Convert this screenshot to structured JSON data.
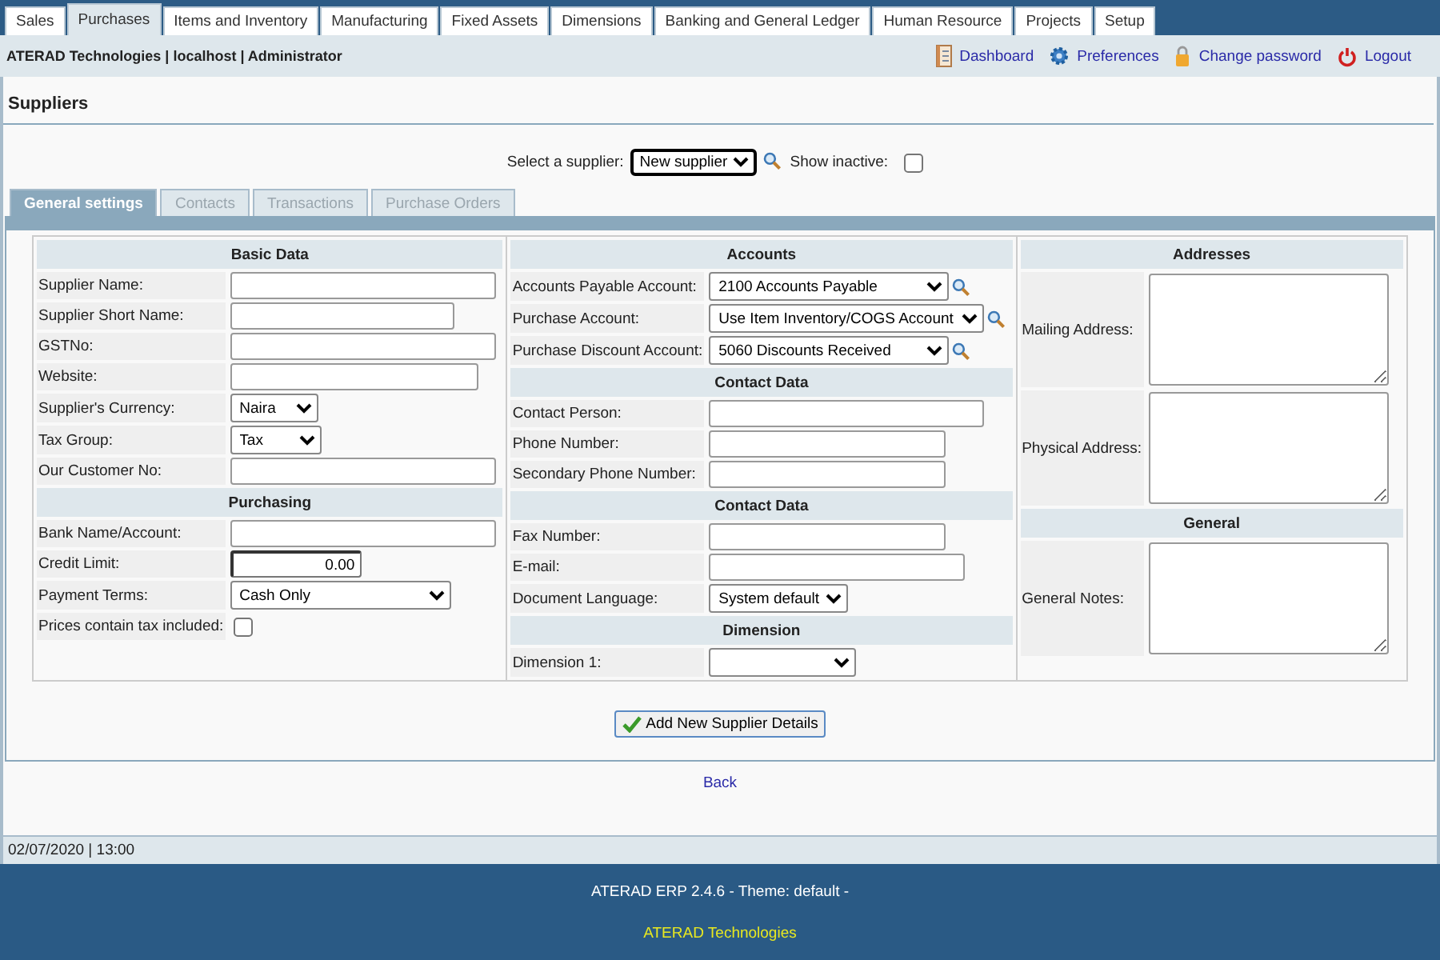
{
  "menu_tabs": [
    {
      "label": "Sales",
      "selected": false
    },
    {
      "label": "Purchases",
      "selected": true
    },
    {
      "label": "Items and Inventory",
      "selected": false
    },
    {
      "label": "Manufacturing",
      "selected": false
    },
    {
      "label": "Fixed Assets",
      "selected": false
    },
    {
      "label": "Dimensions",
      "selected": false
    },
    {
      "label": "Banking and General Ledger",
      "selected": false
    },
    {
      "label": "Human Resource",
      "selected": false
    },
    {
      "label": "Projects",
      "selected": false
    },
    {
      "label": "Setup",
      "selected": false
    }
  ],
  "user_bar": {
    "info": "ATERAD Technologies | localhost | Administrator",
    "links": [
      {
        "label": "Dashboard",
        "kind": "dashboard"
      },
      {
        "label": "Preferences",
        "kind": "preferences"
      },
      {
        "label": "Change password",
        "kind": "password"
      },
      {
        "label": "Logout",
        "kind": "logout"
      }
    ]
  },
  "page_title": "Suppliers",
  "supplier_select": {
    "label": "Select a supplier:",
    "value": "New supplier",
    "show_inactive_label": "Show inactive:",
    "show_inactive": false
  },
  "form_tabs": [
    {
      "label": "General settings",
      "selected": true
    },
    {
      "label": "Contacts",
      "selected": false
    },
    {
      "label": "Transactions",
      "selected": false
    },
    {
      "label": "Purchase Orders",
      "selected": false
    }
  ],
  "columns": [
    [
      {
        "kind": "header",
        "label": "Basic Data"
      },
      {
        "kind": "text",
        "label": "Supplier Name:"
      },
      {
        "kind": "text",
        "label": "Supplier Short Name:"
      },
      {
        "kind": "text",
        "label": "GSTNo:"
      },
      {
        "kind": "text",
        "label": "Website:"
      },
      {
        "kind": "select",
        "label": "Supplier's Currency:",
        "value": "Naira"
      },
      {
        "kind": "select",
        "label": "Tax Group:",
        "value": "Tax"
      },
      {
        "kind": "text",
        "label": "Our Customer No:"
      },
      {
        "kind": "header",
        "label": "Purchasing"
      },
      {
        "kind": "text",
        "label": "Bank Name/Account:"
      },
      {
        "kind": "number",
        "label": "Credit Limit:",
        "value": "0.00"
      },
      {
        "kind": "select",
        "label": "Payment Terms:",
        "value": "Cash Only"
      },
      {
        "kind": "checkbox",
        "label": "Prices contain tax included:",
        "checked": false
      }
    ],
    [
      {
        "kind": "header",
        "label": "Accounts"
      },
      {
        "kind": "account",
        "label": "Accounts Payable Account:",
        "value": "2100    Accounts Payable"
      },
      {
        "kind": "account",
        "label": "Purchase Account:",
        "value": "Use Item Inventory/COGS Account"
      },
      {
        "kind": "account",
        "label": "Purchase Discount Account:",
        "value": "5060    Discounts Received"
      },
      {
        "kind": "header",
        "label": "Contact Data"
      },
      {
        "kind": "text",
        "label": "Contact Person:"
      },
      {
        "kind": "text",
        "label": "Phone Number:"
      },
      {
        "kind": "text",
        "label": "Secondary Phone Number:"
      },
      {
        "kind": "header",
        "label": "Contact Data"
      },
      {
        "kind": "text",
        "label": "Fax Number:"
      },
      {
        "kind": "text",
        "label": "E-mail:"
      },
      {
        "kind": "select",
        "label": "Document Language:",
        "value": "System default"
      },
      {
        "kind": "header",
        "label": "Dimension"
      },
      {
        "kind": "select",
        "label": "Dimension 1:"
      }
    ],
    [
      {
        "kind": "header",
        "label": "Addresses"
      },
      {
        "kind": "textarea",
        "label": "Mailing Address:"
      },
      {
        "kind": "textarea",
        "label": "Physical Address:"
      },
      {
        "kind": "header",
        "label": "General"
      },
      {
        "kind": "textarea",
        "label": "General Notes:"
      }
    ]
  ],
  "submit_button": "Add New Supplier Details",
  "back_link": "Back",
  "status_bar": "02/07/2020 | 13:00",
  "footer": {
    "version": "ATERAD ERP 2.4.6 - Theme: default -",
    "company": "ATERAD Technologies"
  }
}
